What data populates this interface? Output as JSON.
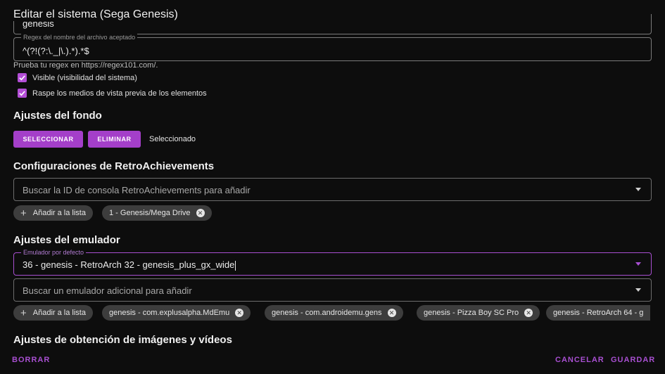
{
  "dialog": {
    "title": "Editar el sistema (Sega Genesis)"
  },
  "fields": {
    "short_name": {
      "value": "genesis"
    },
    "regex": {
      "label": "Regex del nombre del archivo aceptado",
      "value": "^(?!(?:\\._|\\.).*).*$"
    },
    "regex_helper": "Prueba tu regex en https://regex101.com/."
  },
  "checkboxes": {
    "visible": {
      "label": "Visible (visibilidad del sistema)",
      "checked": true
    },
    "scrape": {
      "label": "Raspe los medios de vista previa de los elementos",
      "checked": true
    }
  },
  "background": {
    "title": "Ajustes del fondo",
    "select_label": "SELECCIONAR",
    "delete_label": "ELIMINAR",
    "status": "Seleccionado"
  },
  "retroachievements": {
    "title": "Configuraciones de RetroAchievements",
    "search_placeholder": "Buscar la ID de consola RetroAchievements para añadir",
    "add_label": "Añadir a la lista",
    "chips": [
      "1 - Genesis/Mega Drive"
    ]
  },
  "emulator": {
    "title": "Ajustes del emulador",
    "default_label": "Emulador por defecto",
    "default_value": "36 - genesis - RetroArch 32 - genesis_plus_gx_wide",
    "search_placeholder": "Buscar un emulador adicional para añadir",
    "add_label": "Añadir a la lista",
    "chips": [
      "genesis - com.explusalpha.MdEmu",
      "genesis - com.androidemu.gens",
      "genesis - Pizza Boy SC Pro",
      "genesis - RetroArch 64 - g"
    ]
  },
  "media": {
    "title": "Ajustes de obtención de imágenes y vídeos"
  },
  "footer": {
    "delete_label": "BORRAR",
    "cancel_label": "CANCELAR",
    "save_label": "GUARDAR"
  },
  "colors": {
    "accent": "#a43fc9",
    "background": "#0d0d0d",
    "chip": "#3d3d3d"
  },
  "icons": {
    "check": "check-icon",
    "add": "plus-icon",
    "remove": "close-circle-icon",
    "dropdown": "dropdown-arrow-icon"
  }
}
